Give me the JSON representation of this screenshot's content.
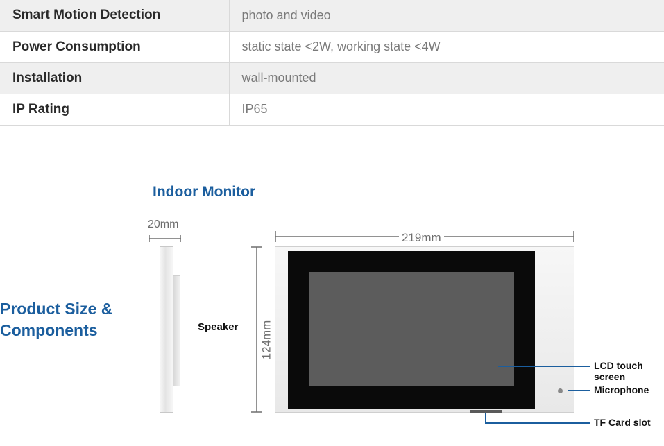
{
  "specs": [
    {
      "label": "Smart Motion Detection",
      "value": "photo and video"
    },
    {
      "label": "Power Consumption",
      "value": "static state <2W, working state <4W"
    },
    {
      "label": "Installation",
      "value": "wall-mounted"
    },
    {
      "label": "IP Rating",
      "value": "IP65"
    }
  ],
  "section_heading_line1": "Product Size &",
  "section_heading_line2": "Components",
  "diagram": {
    "title": "Indoor Monitor",
    "depth": "20mm",
    "width": "219mm",
    "height": "124mm",
    "speaker": "Speaker",
    "callouts": {
      "lcd": "LCD touch screen",
      "mic": "Microphone",
      "tf": "TF Card slot"
    }
  }
}
